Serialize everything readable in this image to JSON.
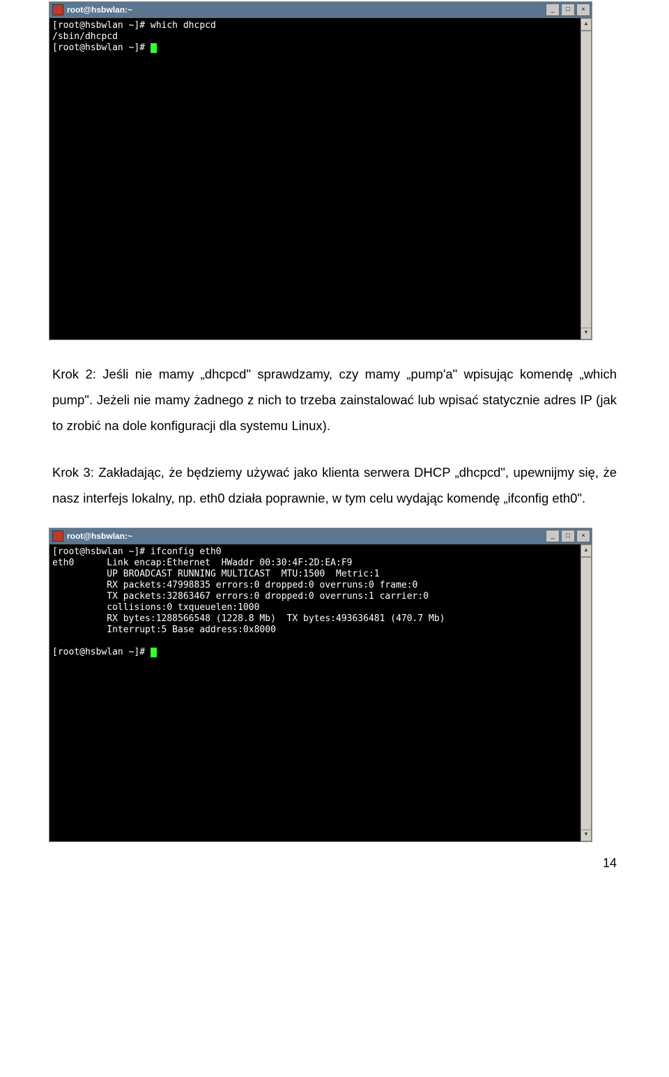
{
  "terminal1": {
    "title": "root@hsbwlan:~",
    "lines": [
      "[root@hsbwlan ~]# which dhcpcd",
      "/sbin/dhcpcd",
      "[root@hsbwlan ~]# "
    ]
  },
  "paragraph1": "Krok 2: Jeśli nie mamy „dhcpcd\" sprawdzamy, czy mamy „pump'a\" wpisując komendę „which pump\". Jeżeli nie mamy żadnego z nich to trzeba zainstalować lub wpisać statycznie adres IP (jak to zrobić na dole konfiguracji dla systemu Linux).",
  "paragraph2": "Krok 3: Zakładając, że będziemy używać jako klienta serwera DHCP „dhcpcd\", upewnijmy się, że nasz interfejs lokalny, np. eth0 działa poprawnie, w tym celu wydając komendę „ifconfig eth0\".",
  "terminal2": {
    "title": "root@hsbwlan:~",
    "lines": [
      "[root@hsbwlan ~]# ifconfig eth0",
      "eth0      Link encap:Ethernet  HWaddr 00:30:4F:2D:EA:F9",
      "          UP BROADCAST RUNNING MULTICAST  MTU:1500  Metric:1",
      "          RX packets:47998835 errors:0 dropped:0 overruns:0 frame:0",
      "          TX packets:32863467 errors:0 dropped:0 overruns:1 carrier:0",
      "          collisions:0 txqueuelen:1000",
      "          RX bytes:1288566548 (1228.8 Mb)  TX bytes:493636481 (470.7 Mb)",
      "          Interrupt:5 Base address:0x8000",
      "",
      "[root@hsbwlan ~]# "
    ]
  },
  "page_number": "14"
}
